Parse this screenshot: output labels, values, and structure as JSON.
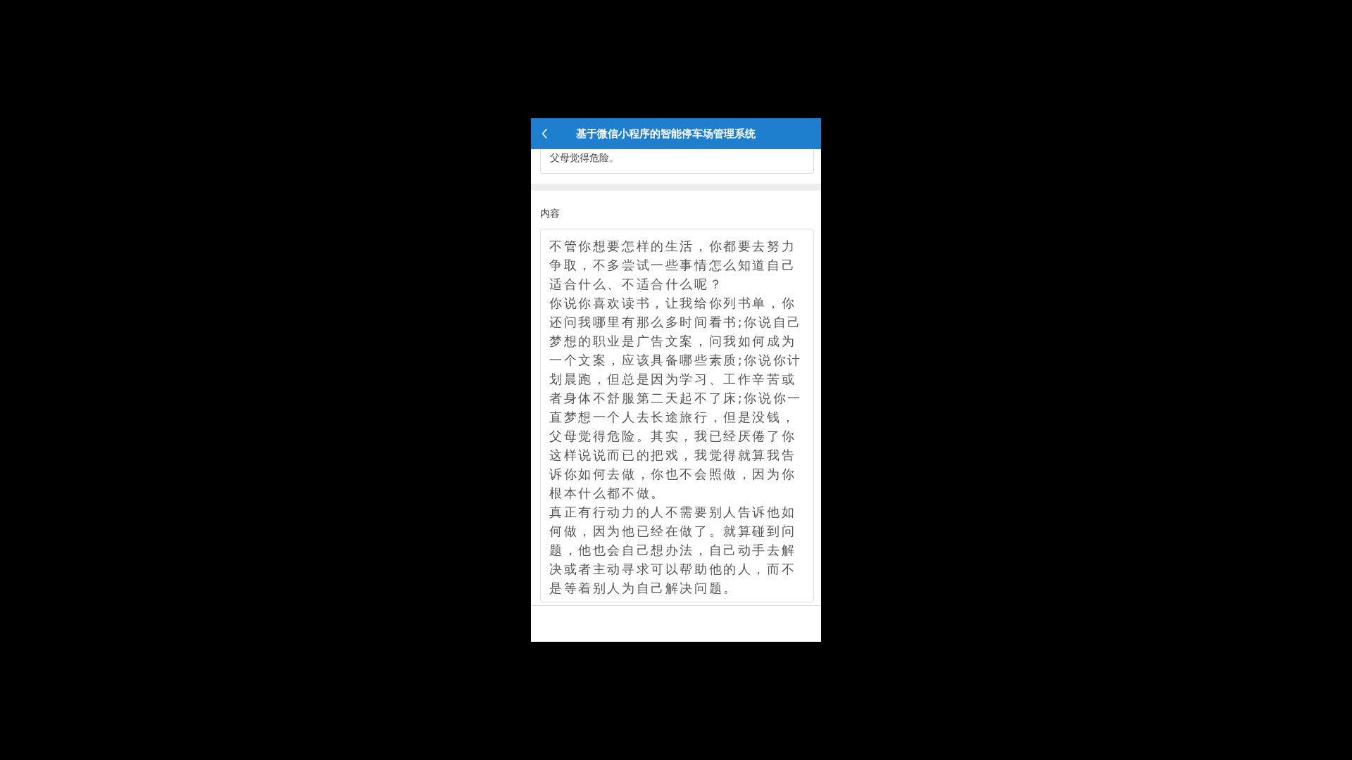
{
  "header": {
    "title": "基于微信小程序的智能停车场管理系统"
  },
  "previous_field": {
    "value_visible": "父母觉得危险。"
  },
  "content_field": {
    "label": "内容",
    "paragraphs": [
      "不管你想要怎样的生活，你都要去努力争取，不多尝试一些事情怎么知道自己适合什么、不适合什么呢？",
      "你说你喜欢读书，让我给你列书单，你还问我哪里有那么多时间看书;你说自己梦想的职业是广告文案，问我如何成为一个文案，应该具备哪些素质;你说你计划晨跑，但总是因为学习、工作辛苦或者身体不舒服第二天起不了床;你说你一直梦想一个人去长途旅行，但是没钱，父母觉得危险。其实，我已经厌倦了你这样说说而已的把戏，我觉得就算我告诉你如何去做，你也不会照做，因为你根本什么都不做。",
      "真正有行动力的人不需要别人告诉他如何做，因为他已经在做了。就算碰到问题，他也会自己想办法，自己动手去解决或者主动寻求可以帮助他的人，而不是等着别人为自己解决问题。"
    ]
  }
}
